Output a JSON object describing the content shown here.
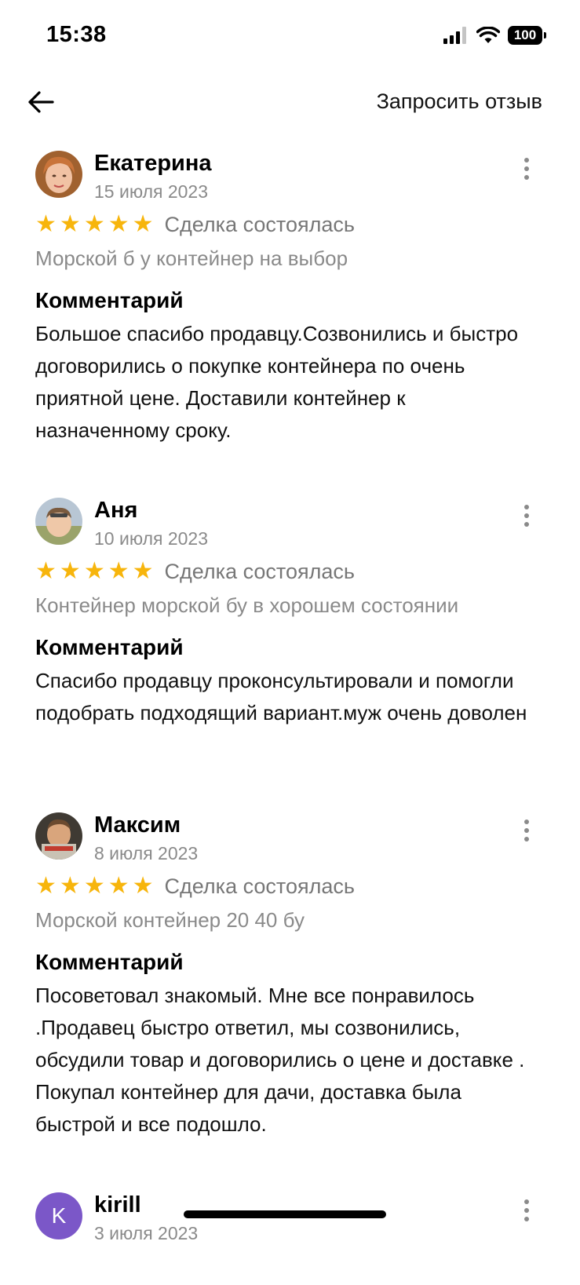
{
  "status": {
    "time": "15:38",
    "battery": "100"
  },
  "nav": {
    "request_review": "Запросить отзыв"
  },
  "reviews": [
    {
      "author": "Екатерина",
      "date": "15 июля 2023",
      "rating": 5,
      "deal_status": "Сделка состоялась",
      "product": "Морской б у контейнер на выбор",
      "comment_title": "Комментарий",
      "comment": "Большое спасибо продавцу.Созвонились и быстро договорились о покупке контейнера по очень приятной цене. Доставили контейнер к назначенному сроку."
    },
    {
      "author": "Аня",
      "date": "10 июля 2023",
      "rating": 5,
      "deal_status": "Сделка состоялась",
      "product": "Контейнер морской бу в хорошем состоянии",
      "comment_title": "Комментарий",
      "comment": "Спасибо продавцу проконсультировали и помогли подобрать подходящий вариант.муж очень доволен"
    },
    {
      "author": "Максим",
      "date": "8 июля 2023",
      "rating": 5,
      "deal_status": "Сделка состоялась",
      "product": "Морской контейнер 20 40 бу",
      "comment_title": "Комментарий",
      "comment": "Посоветовал знакомый. Мне все понравилось .Продавец быстро ответил, мы созвонились,  обсудили товар и  договорились о цене и доставке . Покупал  контейнер  для дачи, доставка была быстрой и все подошло."
    },
    {
      "author": "kirill",
      "date": "3 июля 2023",
      "avatar_letter": "K"
    }
  ],
  "colors": {
    "star": "#f7b50c",
    "avatar_letter_bg": "#7b57c8",
    "secondary_text": "#8a8a8a"
  }
}
